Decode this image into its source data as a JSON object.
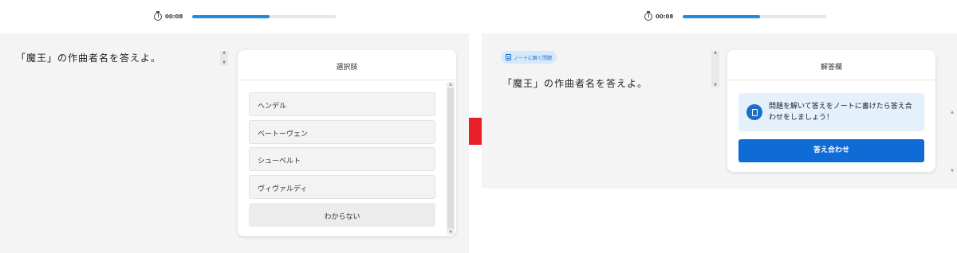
{
  "left": {
    "timer": {
      "time": "00:08",
      "progress_percent": 54
    },
    "question": "「魔王」の作曲者名を答えよ。",
    "choices_card": {
      "title": "選択肢",
      "choices": [
        "ヘンデル",
        "ベートーヴェン",
        "シューベルト",
        "ヴィヴァルディ"
      ],
      "unknown_label": "わからない"
    }
  },
  "right": {
    "timer": {
      "time": "00:08",
      "progress_percent": 54
    },
    "tag_label": "ノートに解く問題",
    "question": "「魔王」の作曲者名を答えよ。",
    "answer_card": {
      "title": "解答欄",
      "info_text": "問題を解いて答えをノートに書けたら答え合わせをしましょう！",
      "check_button_label": "答え合わせ"
    }
  },
  "colors": {
    "accent": "#0f6bd6",
    "progress": "#1f8bde",
    "arrow": "#e8202a",
    "panel_bg": "#f4f4f4"
  },
  "icons": [
    "stopwatch-icon",
    "notebook-icon",
    "arrow-right-icon",
    "scroll-up-icon",
    "scroll-down-icon"
  ]
}
